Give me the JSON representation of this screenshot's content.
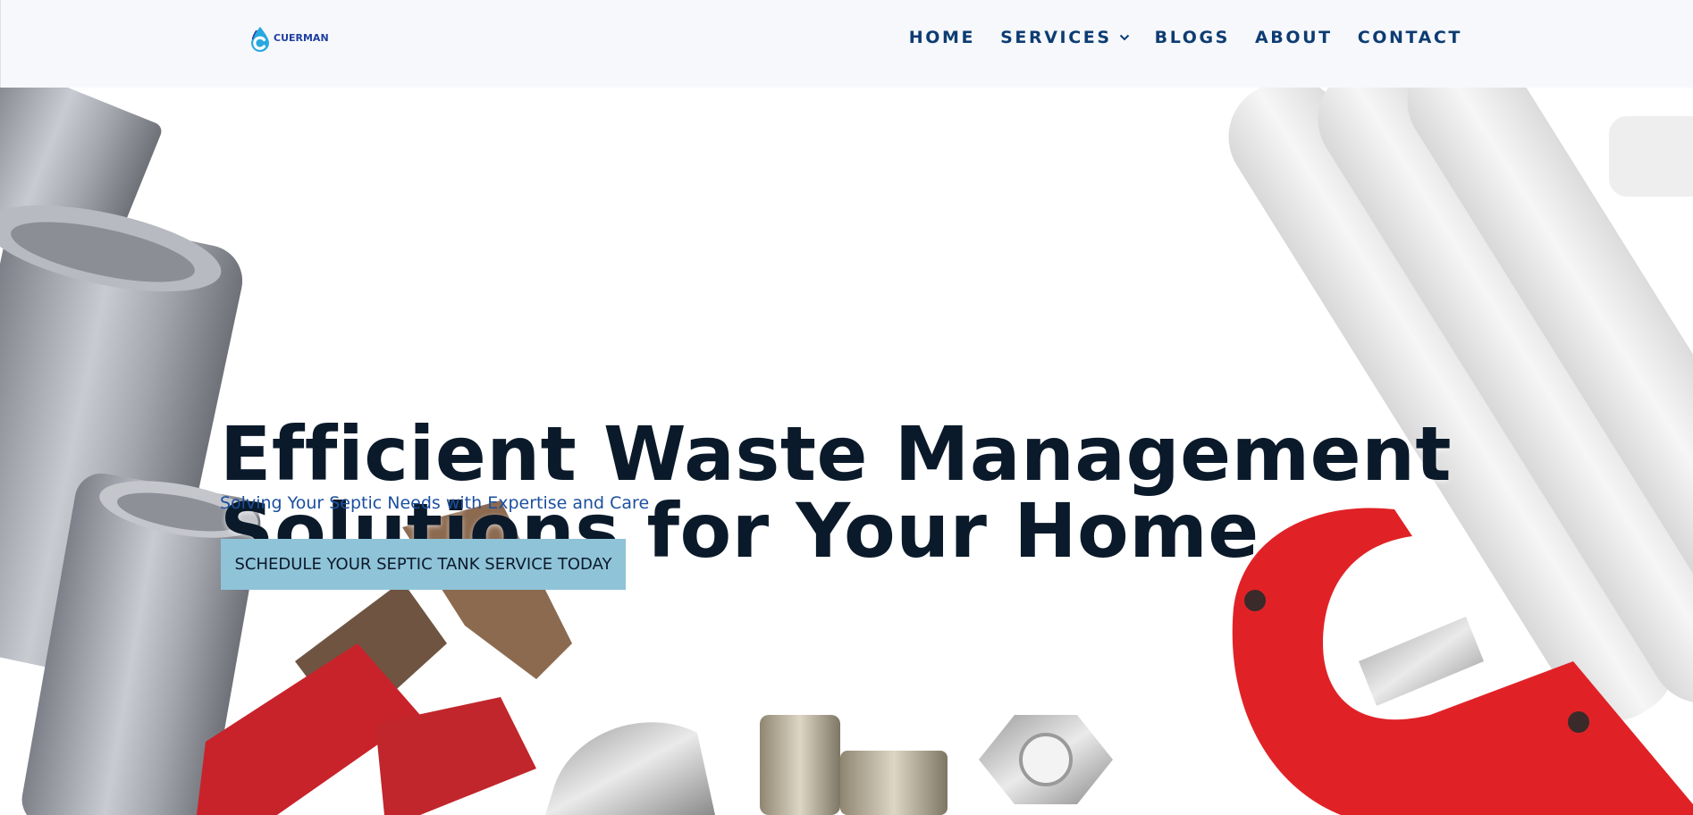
{
  "brand": {
    "name": "CUERMAN",
    "logo_icon": "water-drop-c-icon",
    "accent": "#1f3fa0"
  },
  "nav": {
    "items": [
      {
        "label": "HOME",
        "has_dropdown": false
      },
      {
        "label": "SERVICES",
        "has_dropdown": true,
        "dropdown_icon": "chevron-down-icon"
      },
      {
        "label": "BLOGS",
        "has_dropdown": false
      },
      {
        "label": "ABOUT",
        "has_dropdown": false
      },
      {
        "label": "CONTACT",
        "has_dropdown": false
      }
    ],
    "color": "#0d3c72"
  },
  "hero": {
    "headline_line1": "Efficient Waste Management",
    "headline_line2": "Solutions for Your Home",
    "subtitle": "Solving Your Septic Needs with Expertise and Care",
    "cta_label": "SCHEDULE YOUR SEPTIC TANK SERVICE TODAY",
    "cta_color": "#8fc3d8",
    "background_image": "plumbing-tools-and-pipes"
  }
}
